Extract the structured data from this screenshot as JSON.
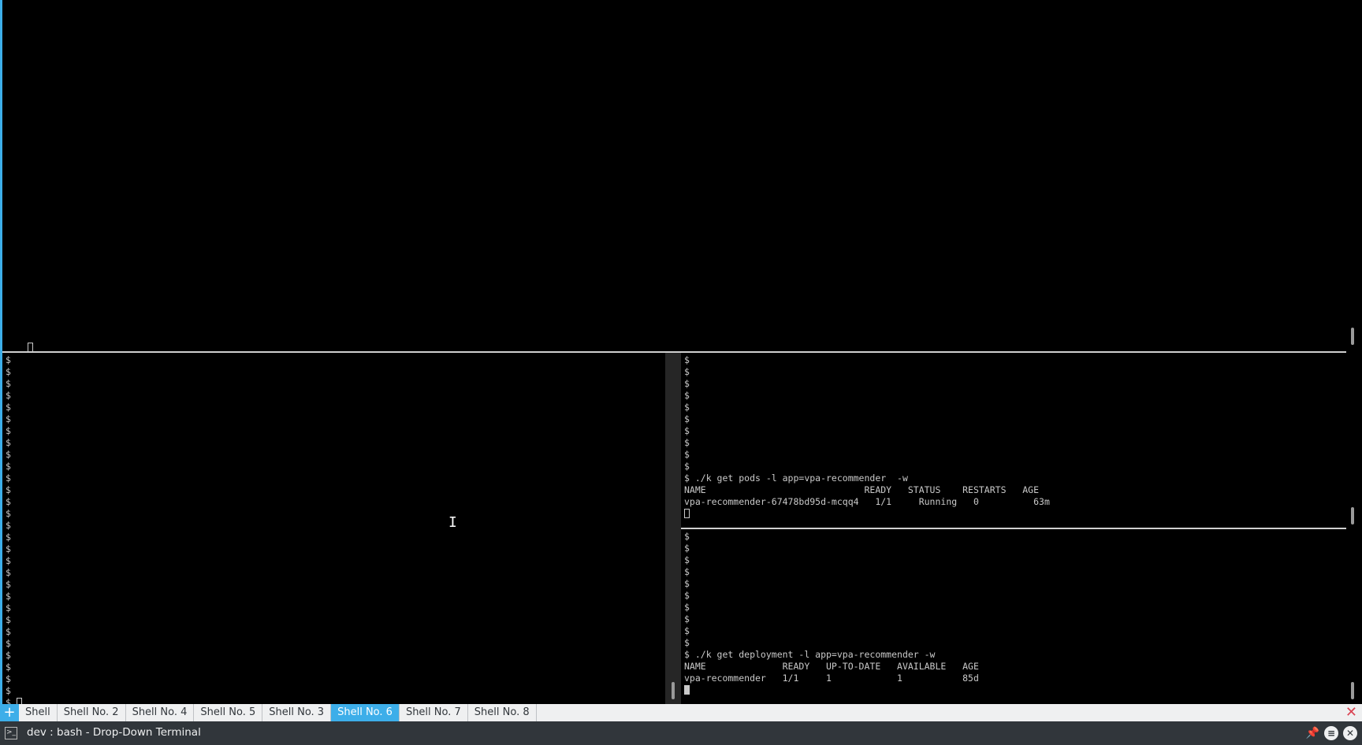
{
  "top_pane": {
    "lines": [
      ""
    ],
    "cursor": "hollow"
  },
  "left_pane": {
    "lines": [
      "$",
      "$",
      "$",
      "$",
      "$",
      "$",
      "$",
      "$",
      "$",
      "$",
      "$",
      "$",
      "$",
      "$",
      "$",
      "$",
      "$",
      "$",
      "$",
      "$",
      "$",
      "$",
      "$",
      "$",
      "$",
      "$",
      "$",
      "$",
      "$"
    ],
    "last_line": "$ "
  },
  "right_top_pane": {
    "lines": [
      "$",
      "$",
      "$",
      "$",
      "$",
      "$",
      "$",
      "$",
      "$",
      "$",
      "$ ./k get pods -l app=vpa-recommender  -w",
      "NAME                             READY   STATUS    RESTARTS   AGE",
      "vpa-recommender-67478bd95d-mcqq4   1/1     Running   0          63m"
    ]
  },
  "right_bottom_pane": {
    "lines": [
      "$",
      "$",
      "$",
      "$",
      "$",
      "$",
      "$",
      "$",
      "$",
      "$",
      "$ ./k get deployment -l app=vpa-recommender -w",
      "NAME              READY   UP-TO-DATE   AVAILABLE   AGE",
      "vpa-recommender   1/1     1            1           85d"
    ]
  },
  "tabbar": {
    "new_tab_icon": "plus-icon",
    "tabs": [
      {
        "label": "Shell",
        "active": false
      },
      {
        "label": "Shell No. 2",
        "active": false
      },
      {
        "label": "Shell No. 4",
        "active": false
      },
      {
        "label": "Shell No. 5",
        "active": false
      },
      {
        "label": "Shell No. 3",
        "active": false
      },
      {
        "label": "Shell No. 6",
        "active": true
      },
      {
        "label": "Shell No. 7",
        "active": false
      },
      {
        "label": "Shell No. 8",
        "active": false
      }
    ],
    "close_icon": "close-icon"
  },
  "titlebar": {
    "title": "dev : bash - Drop-Down Terminal",
    "icon": "terminal-icon",
    "buttons": [
      "pin-icon",
      "menu-icon",
      "close-icon"
    ]
  },
  "colors": {
    "accent": "#3daee9",
    "terminal_bg": "#000000",
    "terminal_fg": "#c9c9c9",
    "titlebar_bg": "#31363b",
    "tabbar_bg": "#eff0f1"
  }
}
